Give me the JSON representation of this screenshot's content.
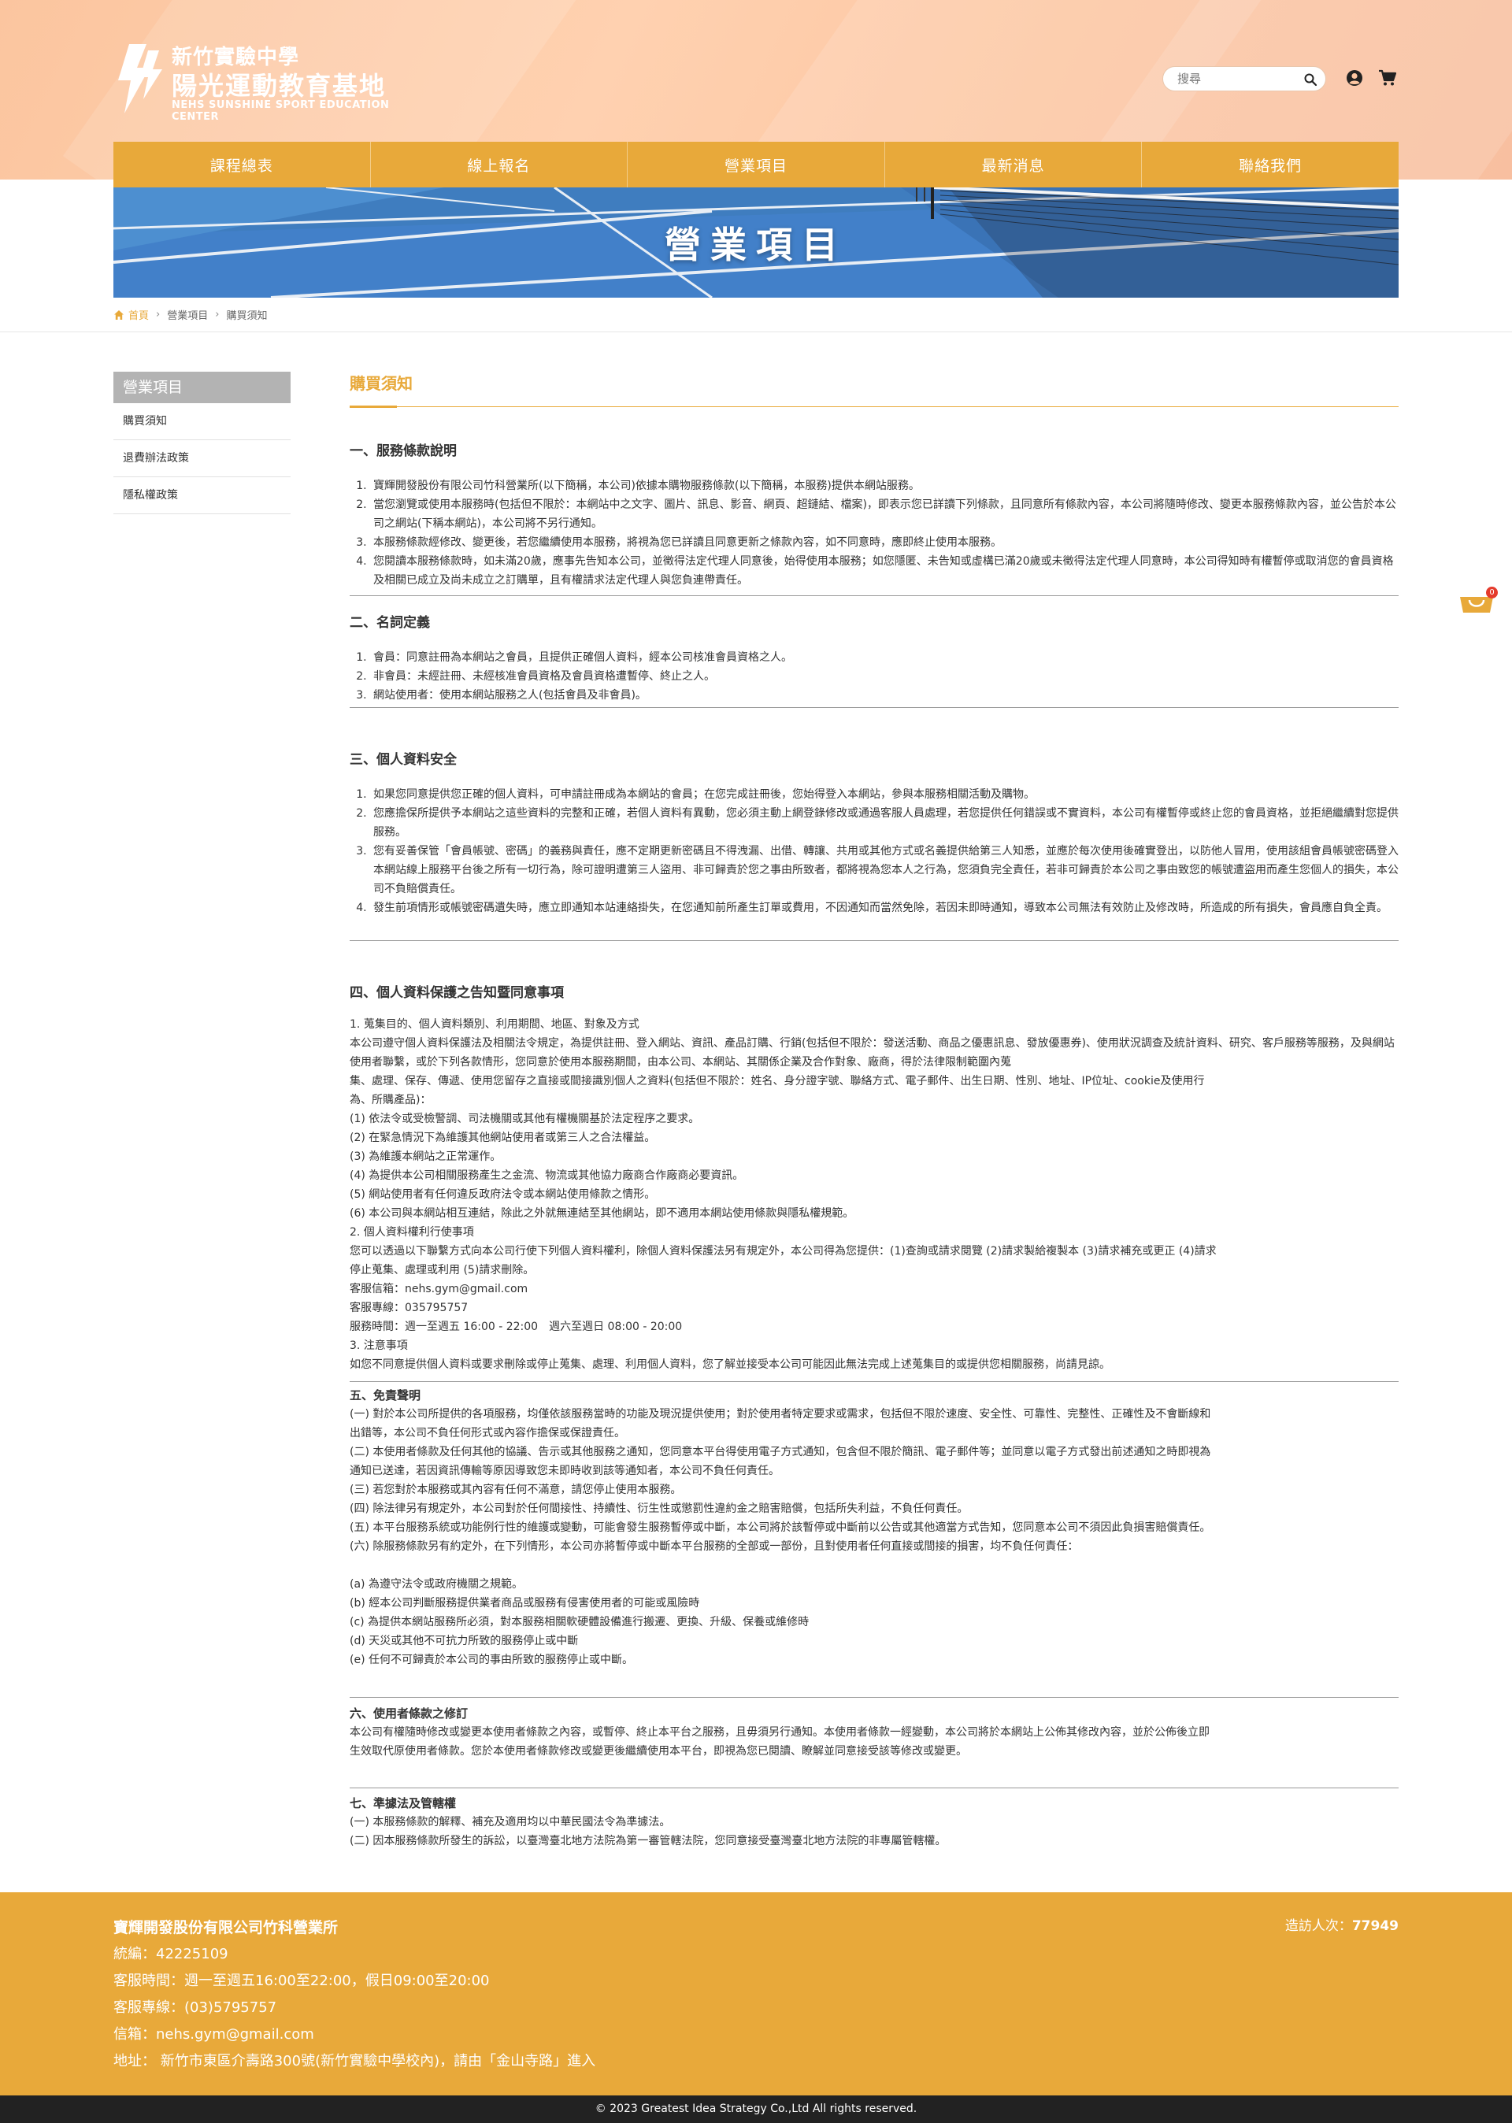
{
  "header": {
    "logo_line1": "新竹實驗中學",
    "logo_line2": "陽光運動教育基地",
    "logo_line3": "NEHS SUNSHINE SPORT EDUCATION CENTER",
    "search_placeholder": "搜尋",
    "icons": [
      "search-icon",
      "user-icon",
      "cart-icon"
    ]
  },
  "nav": {
    "items": [
      "課程總表",
      "線上報名",
      "營業項目",
      "最新消息",
      "聯絡我們"
    ]
  },
  "banner": {
    "title": "營業項目"
  },
  "breadcrumb": {
    "home": "首頁",
    "level1": "營業項目",
    "level2": "購買須知"
  },
  "sidebar": {
    "title": "營業項目",
    "items": [
      "購買須知",
      "退費辦法政策",
      "隱私權政策"
    ]
  },
  "content": {
    "title": "購買須知",
    "s1": {
      "title": "一、服務條款說明",
      "items": [
        "寶輝開發股份有限公司竹科營業所(以下簡稱，本公司)依據本購物服務條款(以下簡稱，本服務)提供本網站服務。",
        "當您瀏覽或使用本服務時(包括但不限於：本網站中之文字、圖片、訊息、影音、網頁、超鏈結、檔案)，即表示您已詳讀下列條款，且同意所有條款內容，本公司將隨時修改、變更本服務條款內容，並公告於本公司之網站(下稱本網站)，本公司將不另行通知。",
        "本服務條款經修改、變更後，若您繼續使用本服務，將視為您已詳讀且同意更新之條款內容，如不同意時，應即終止使用本服務。",
        "您閱讀本服務條款時，如未滿20歲，應事先告知本公司，並徵得法定代理人同意後，始得使用本服務；如您隱匿、未告知或虛構已滿20歲或未徵得法定代理人同意時，本公司得知時有權暫停或取消您的會員資格及相關已成立及尚未成立之訂購單，且有權請求法定代理人與您負連帶責任。"
      ]
    },
    "s2": {
      "title": "二、名詞定義",
      "items": [
        "會員：同意註冊為本網站之會員，且提供正確個人資料，經本公司核准會員資格之人。",
        "非會員：未經註冊、未經核准會員資格及會員資格遭暫停、終止之人。",
        "網站使用者：使用本網站服務之人(包括會員及非會員)。"
      ]
    },
    "s3": {
      "title": "三、個人資料安全",
      "items": [
        "如果您同意提供您正確的個人資料，可申請註冊成為本網站的會員；在您完成註冊後，您始得登入本網站，參與本服務相關活動及購物。",
        "您應擔保所提供予本網站之這些資料的完整和正確，若個人資料有異動，您必須主動上網登錄修改或通過客服人員處理，若您提供任何錯誤或不實資料，本公司有權暫停或終止您的會員資格，並拒絕繼續對您提供服務。",
        "您有妥善保管「會員帳號、密碼」的義務與責任，應不定期更新密碼且不得洩漏、出借、轉讓、共用或其他方式或名義提供給第三人知悉，並應於每次使用後確實登出，以防他人冒用，使用該組會員帳號密碼登入本網站線上服務平台後之所有一切行為，除可證明遭第三人盜用、非可歸責於您之事由所致者，都將視為您本人之行為，您須負完全責任，若非可歸責於本公司之事由致您的帳號遭盜用而產生您個人的損失，本公司不負賠償責任。",
        "發生前項情形或帳號密碼遺失時，應立即通知本站連絡掛失，在您通知前所產生訂單或費用，不因通知而當然免除，若因未即時通知，導致本公司無法有效防止及修改時，所造成的所有損失，會員應自負全責。"
      ]
    },
    "s4": {
      "title": "四、個人資料保護之告知暨同意事項",
      "lines": [
        "1. 蒐集目的、個人資料類別、利用期間、地區、對象及方式",
        "本公司遵守個人資料保護法及相關法令規定，為提供註冊、登入網站、資訊、產品訂購、行銷(包括但不限於：發送活動、商品之優惠訊息、發放優惠券)、使用狀況調查及統計資料、研究、客戶服務等服務，及與網站使用者聯繫，或於下列各款情形，您同意於使用本服務期間，由本公司、本網站、其關係企業及合作對象、廠商，得於法律限制範圍內蒐",
        "集、處理、保存、傳遞、使用您留存之直接或間接識別個人之資料(包括但不限於：姓名、身分證字號、聯絡方式、電子郵件、出生日期、性別、地址、IP位址、cookie及使用行",
        "為、所購產品)：",
        "(1) 依法令或受檢警調、司法機關或其他有權機關基於法定程序之要求。",
        "(2) 在緊急情況下為維護其他網站使用者或第三人之合法權益。",
        "(3) 為維護本網站之正常運作。",
        "(4) 為提供本公司相關服務產生之金流、物流或其他協力廠商合作廠商必要資訊。",
        "(5) 網站使用者有任何違反政府法令或本網站使用條款之情形。",
        "(6) 本公司與本網站相互連結，除此之外就無連結至其他網站，即不適用本網站使用條款與隱私權規範。",
        "2. 個人資料權利行使事項",
        "您可以透過以下聯繫方式向本公司行使下列個人資料權利，除個人資料保護法另有規定外，本公司得為您提供：(1)查詢或請求閱覽 (2)請求製給複製本 (3)請求補充或更正 (4)請求",
        "停止蒐集、處理或利用 (5)請求刪除。",
        "客服信箱：nehs.gym@gmail.com",
        "客服專線：035795757",
        "服務時間：週一至週五 16:00 - 22:00　週六至週日 08:00 - 20:00",
        "3. 注意事項",
        "如您不同意提供個人資料或要求刪除或停止蒐集、處理、利用個人資料，您了解並接受本公司可能因此無法完成上述蒐集目的或提供您相關服務，尚請見諒。"
      ]
    },
    "s5": {
      "title": "五、免責聲明",
      "lines": [
        "(一) 對於本公司所提供的各項服務，均僅依該服務當時的功能及現況提供使用；對於使用者特定要求或需求，包括但不限於速度、安全性、可靠性、完整性、正確性及不會斷線和",
        "出錯等，本公司不負任何形式或內容作擔保或保證責任。",
        "(二) 本使用者條款及任何其他的協議、告示或其他服務之通知，您同意本平台得使用電子方式通知，包含但不限於簡訊、電子郵件等；並同意以電子方式發出前述通知之時即視為",
        "通知已送達，若因資訊傳輸等原因導致您未即時收到該等通知者，本公司不負任何責任。",
        "(三) 若您對於本服務或其內容有任何不滿意，請您停止使用本服務。",
        "(四) 除法律另有規定外，本公司對於任何間接性、持續性、衍生性或懲罰性違約金之賠害賠償，包括所失利益，不負任何責任。",
        "(五) 本平台服務系統或功能例行性的維護或變動，可能會發生服務暫停或中斷，本公司將於該暫停或中斷前以公告或其他適當方式告知，您同意本公司不須因此負損害賠償責任。",
        "(六) 除服務條款另有約定外，在下列情形，本公司亦將暫停或中斷本平台服務的全部或一部份，且對使用者任何直接或間接的損害，均不負任何責任：",
        "",
        "(a) 為遵守法令或政府機關之規範。",
        "(b) 經本公司判斷服務提供業者商品或服務有侵害使用者的可能或風險時",
        "(c) 為提供本網站服務所必須，對本服務相關軟硬體設備進行搬遷、更換、升級、保養或維修時",
        "(d) 天災或其他不可抗力所致的服務停止或中斷",
        "(e) 任何不可歸責於本公司的事由所致的服務停止或中斷。"
      ]
    },
    "s6": {
      "title": "六、使用者條款之修訂",
      "lines": [
        "本公司有權隨時修改或變更本使用者條款之內容，或暫停、終止本平台之服務，且毋須另行通知。本使用者條款一經變動，本公司將於本網站上公佈其修改內容，並於公佈後立即",
        "生效取代原使用者條款。您於本使用者條款修改或變更後繼續使用本平台，即視為您已閱讀、瞭解並同意接受該等修改或變更。"
      ]
    },
    "s7": {
      "title": "七、準據法及管轄權",
      "lines": [
        "(一) 本服務條款的解釋、補充及適用均以中華民國法令為準據法。",
        "(二) 因本服務條款所發生的訴訟，以臺灣臺北地方法院為第一審管轄法院，您同意接受臺灣臺北地方法院的非專屬管轄權。"
      ]
    }
  },
  "floating_cart": {
    "count": "0"
  },
  "footer": {
    "company": "寶輝開發股份有限公司竹科營業所",
    "tax_id": "統編：42225109",
    "hours": "客服時間：週一至週五16:00至22:00，假日09:00至20:00",
    "phone": "客服專線：(03)5795757",
    "email": "信箱：nehs.gym@gmail.com",
    "address": "地址： 新竹市東區介壽路300號(新竹實驗中學校內)，請由「金山寺路」進入",
    "visits_label": "造訪人次：",
    "visits_count": "77949",
    "copyright": "© 2023 Greatest Idea Strategy Co.,Ltd All rights reserved."
  },
  "colors": {
    "accent": "#e8a93a",
    "header_bg": "#fcc6a2",
    "sidebar_head": "#b3b3b3",
    "court_blue": "#3d79c4"
  }
}
